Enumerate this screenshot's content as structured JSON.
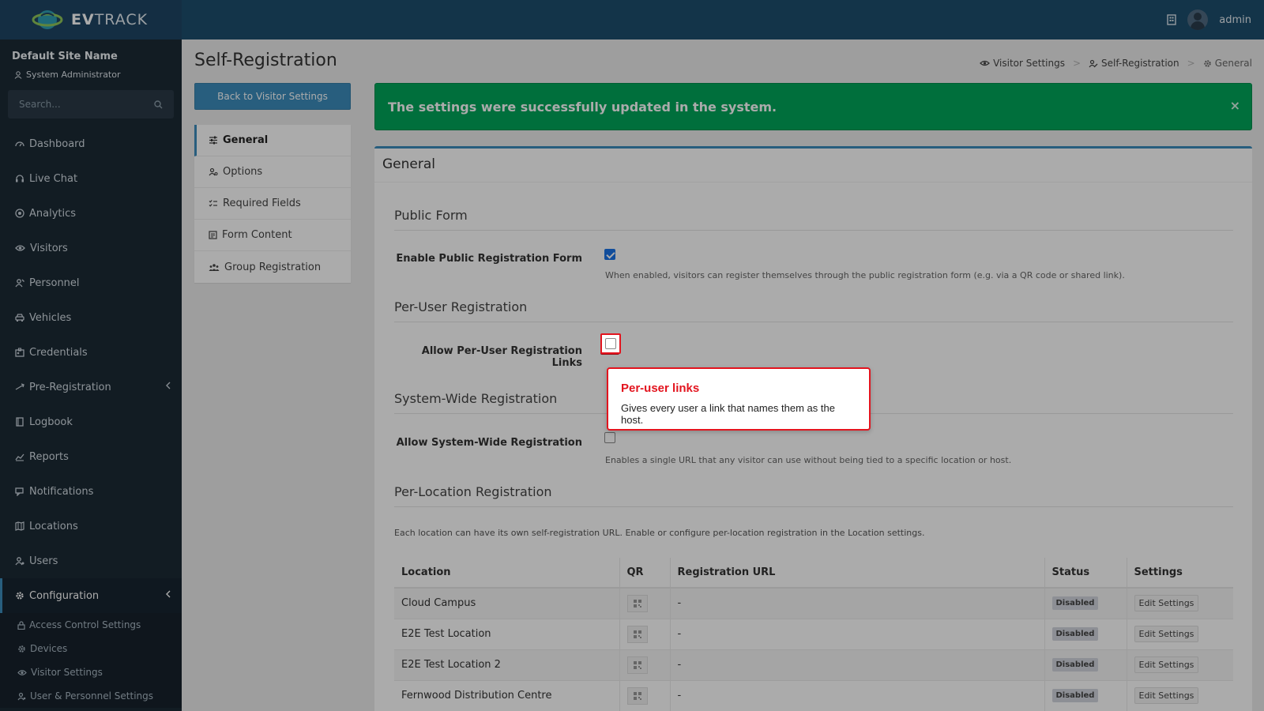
{
  "header": {
    "brand_bold": "EV",
    "brand_rest": "TRACK",
    "user_name": "admin"
  },
  "sidebar": {
    "site_name": "Default Site Name",
    "role": "System Administrator",
    "search_placeholder": "Search...",
    "items": [
      {
        "label": "Dashboard"
      },
      {
        "label": "Live Chat"
      },
      {
        "label": "Analytics"
      },
      {
        "label": "Visitors"
      },
      {
        "label": "Personnel"
      },
      {
        "label": "Vehicles"
      },
      {
        "label": "Credentials"
      },
      {
        "label": "Pre-Registration"
      },
      {
        "label": "Logbook"
      },
      {
        "label": "Reports"
      },
      {
        "label": "Notifications"
      },
      {
        "label": "Locations"
      },
      {
        "label": "Users"
      },
      {
        "label": "Configuration"
      }
    ],
    "sub_items": [
      {
        "label": "Access Control Settings"
      },
      {
        "label": "Devices"
      },
      {
        "label": "Visitor Settings"
      },
      {
        "label": "User & Personnel Settings"
      }
    ]
  },
  "page": {
    "title": "Self-Registration",
    "breadcrumb": [
      "Visitor Settings",
      "Self-Registration",
      "General"
    ],
    "back_button": "Back to Visitor Settings",
    "settings_nav": [
      "General",
      "Options",
      "Required Fields",
      "Form Content",
      "Group Registration"
    ],
    "alert": "The settings were successfully updated in the system.",
    "alert_close": "×"
  },
  "general_box": {
    "title": "General",
    "public_form": {
      "heading": "Public Form",
      "label": "Enable Public Registration Form",
      "checked": true,
      "help": "When enabled, visitors can register themselves through the public registration form (e.g. via a QR code or shared link)."
    },
    "per_user": {
      "heading": "Per-User Registration",
      "label": "Allow Per-User Registration Links",
      "checked": false
    },
    "system_wide": {
      "heading": "System-Wide Registration",
      "label": "Allow System-Wide Registration",
      "checked": false,
      "help": "Enables a single URL that any visitor can use without being tied to a specific location or host."
    },
    "per_location": {
      "heading": "Per-Location Registration",
      "note": "Each location can have its own self-registration URL. Enable or configure per-location registration in the Location settings.",
      "columns": [
        "Location",
        "QR",
        "Registration URL",
        "Status",
        "Settings"
      ],
      "rows": [
        {
          "location": "Cloud Campus",
          "url": "-",
          "status": "Disabled",
          "action": "Edit Settings"
        },
        {
          "location": "E2E Test Location",
          "url": "-",
          "status": "Disabled",
          "action": "Edit Settings"
        },
        {
          "location": "E2E Test Location 2",
          "url": "-",
          "status": "Disabled",
          "action": "Edit Settings"
        },
        {
          "location": "Fernwood Distribution Centre",
          "url": "-",
          "status": "Disabled",
          "action": "Edit Settings"
        }
      ]
    }
  },
  "tooltip": {
    "title": "Per-user links",
    "body": "Gives every user a link that names them as the host."
  },
  "colors": {
    "topbar": "#1d4e6e",
    "sidebar": "#1c2a35",
    "accent": "#3c8dbc",
    "success": "#00a65a",
    "highlight": "#e3141e"
  }
}
